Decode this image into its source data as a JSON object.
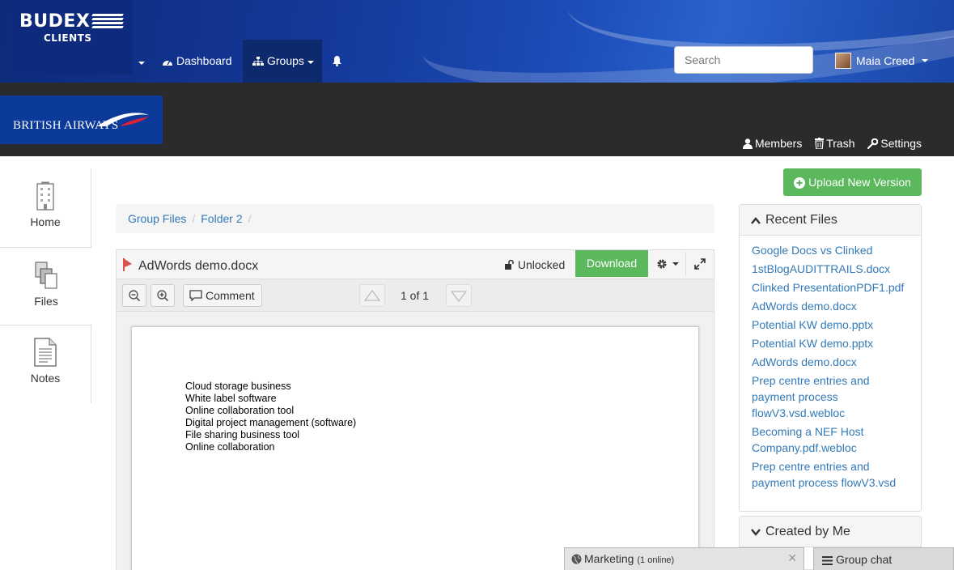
{
  "brand": {
    "name": "BUDEX",
    "sub": "CLIENTS"
  },
  "nav": {
    "dashboard": "Dashboard",
    "groups": "Groups"
  },
  "search": {
    "placeholder": "Search"
  },
  "user": {
    "name": "Maia Creed"
  },
  "group": {
    "logo_text": "BRITISH AIRWAYS",
    "links": {
      "members": "Members",
      "trash": "Trash",
      "settings": "Settings"
    }
  },
  "sidebar": {
    "items": [
      {
        "label": "Home"
      },
      {
        "label": "Files"
      },
      {
        "label": "Notes"
      }
    ]
  },
  "breadcrumb": {
    "items": [
      "Group Files",
      "Folder 2"
    ],
    "separator": "/"
  },
  "viewer": {
    "title": "AdWords demo.docx",
    "lock_status": "Unlocked",
    "download_label": "Download",
    "comment_label": "Comment",
    "page_indicator": "1 of 1",
    "document_lines": [
      "Cloud storage business",
      "White label software",
      "Online collaboration tool",
      "Digital project management (software)",
      "File sharing business tool",
      "Online collaboration"
    ]
  },
  "upload": {
    "label": "Upload New Version"
  },
  "recent_files": {
    "title": "Recent Files",
    "items": [
      "Google Docs vs Clinked",
      "1stBlogAUDITTRAILS.docx",
      "Clinked PresentationPDF1.pdf",
      "AdWords demo.docx",
      "Potential KW demo.pptx",
      "Potential KW demo.pptx",
      "AdWords demo.docx",
      "Prep centre entries and payment process flowV3.vsd.webloc",
      "Becoming a NEF Host Company.pdf.webloc",
      "Prep centre entries and payment process flowV3.vsd"
    ]
  },
  "created_by_me": {
    "title": "Created by Me"
  },
  "chat": {
    "marketing_name": "Marketing",
    "marketing_status": "(1 online)",
    "close": "✕",
    "group_chat": "Group chat"
  },
  "colors": {
    "brand_blue": "#14399a",
    "success_green": "#5cb85c",
    "link_blue": "#337ab7",
    "group_bar": "#2b2b2b"
  }
}
